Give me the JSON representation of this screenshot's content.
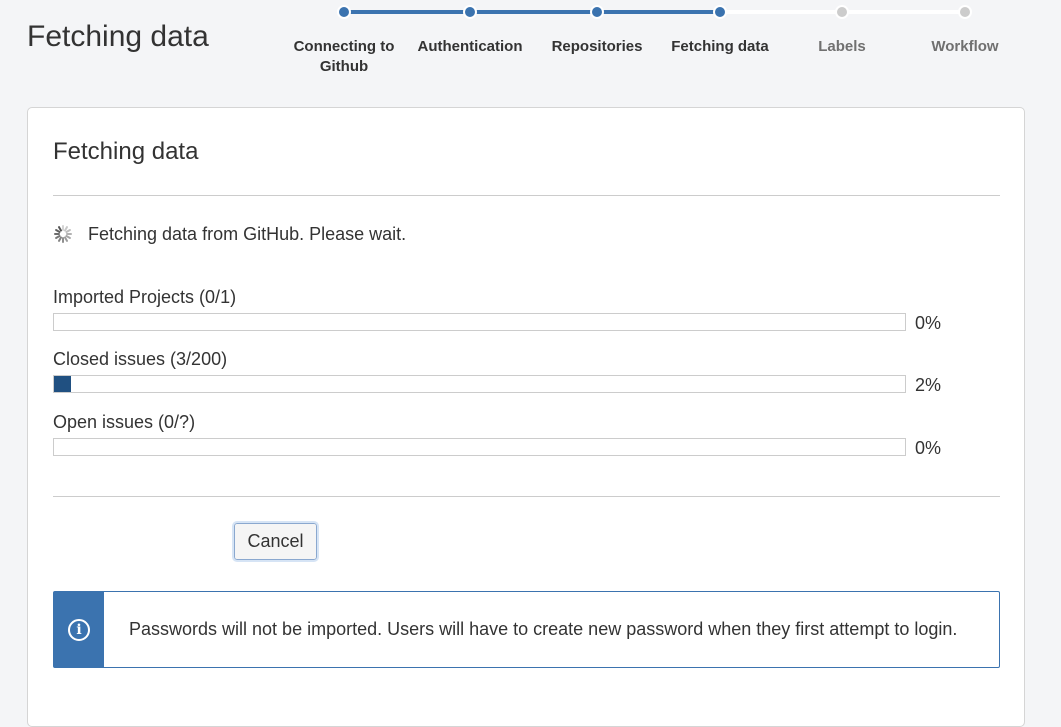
{
  "page": {
    "title": "Fetching data"
  },
  "steps": [
    {
      "label": "Connecting to Github",
      "state": "done"
    },
    {
      "label": "Authentication",
      "state": "done"
    },
    {
      "label": "Repositories",
      "state": "done"
    },
    {
      "label": "Fetching data",
      "state": "current"
    },
    {
      "label": "Labels",
      "state": "pending"
    },
    {
      "label": "Workflow",
      "state": "pending"
    }
  ],
  "panel": {
    "heading": "Fetching data",
    "status_text": "Fetching data from GitHub. Please wait.",
    "status_icon": "spinner-icon"
  },
  "progress": [
    {
      "label": "Imported Projects (0/1)",
      "percent_text": "0%",
      "fraction": 0.0
    },
    {
      "label": "Closed issues (3/200)",
      "percent_text": "2%",
      "fraction": 0.02
    },
    {
      "label": "Open issues (0/?)",
      "percent_text": "0%",
      "fraction": 0.0
    }
  ],
  "actions": {
    "cancel_label": "Cancel"
  },
  "notice": {
    "icon": "info-icon",
    "text": "Passwords will not be imported. Users will have to create new password when they first attempt to login."
  },
  "colors": {
    "accent": "#3b73af",
    "bar_fill": "#205081",
    "pending": "#cccccc"
  }
}
